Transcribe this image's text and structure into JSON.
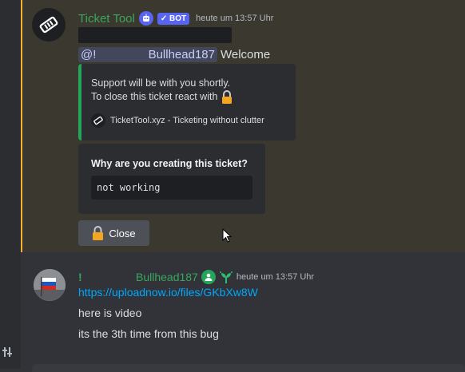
{
  "message1": {
    "author": "Ticket Tool",
    "bot_badge": "✓ BOT",
    "timestamp": "heute um 13:57 Uhr",
    "mention_prefix": "@!",
    "mention_name": "Bullhead187",
    "welcome": "Welcome",
    "embed": {
      "line1": "Support will be with you shortly.",
      "line2": "To close this ticket react with",
      "footer": "TicketTool.xyz - Ticketing without clutter"
    },
    "question": {
      "title": "Why are you creating this ticket?",
      "answer": "not working"
    },
    "close_button": "Close"
  },
  "message2": {
    "prefix": "!",
    "author": "Bullhead187",
    "timestamp": "heute um 13:57 Uhr",
    "link": "https://uploadnow.io/files/GKbXw8W",
    "line1": "here is video",
    "line2": "its the 3th time from this bug"
  },
  "colors": {
    "accent_green": "#3ba55d",
    "highlight_border": "#f0b232",
    "link": "#00a8fc",
    "blurple": "#5865f2"
  },
  "icons": [
    "ticket-icon",
    "robot-icon",
    "lock-icon",
    "user-badge-icon",
    "sprout-icon",
    "cursor-icon"
  ]
}
